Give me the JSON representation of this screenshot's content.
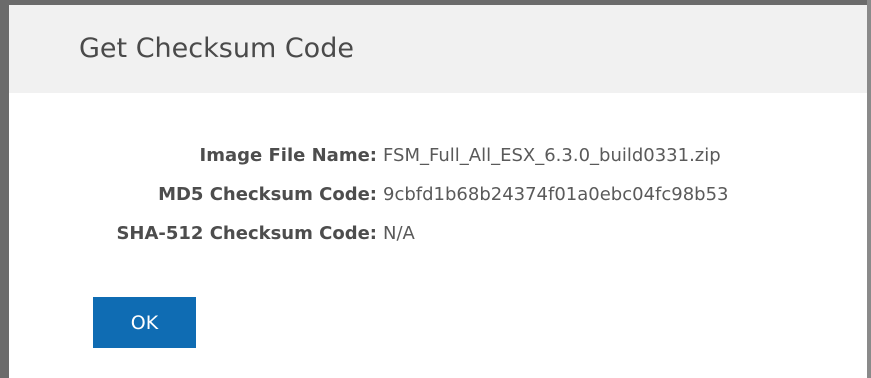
{
  "dialog": {
    "title": "Get Checksum Code",
    "fields": [
      {
        "label": "Image File Name:",
        "value": "FSM_Full_All_ESX_6.3.0_build0331.zip"
      },
      {
        "label": "MD5 Checksum Code:",
        "value": "9cbfd1b68b24374f01a0ebc04fc98b53"
      },
      {
        "label": "SHA-512 Checksum Code:",
        "value": "N/A"
      }
    ],
    "ok_label": "OK",
    "colors": {
      "button": "#0f6cb3",
      "header_bg": "#f1f1f1"
    }
  }
}
